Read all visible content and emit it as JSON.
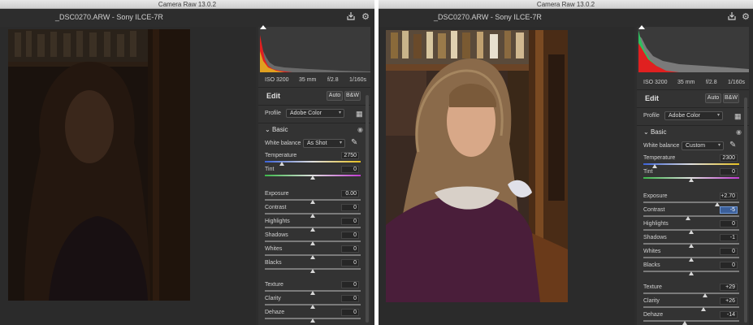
{
  "app_title": "Camera Raw 13.0.2",
  "file_info": "_DSC0270.ARW  -  Sony ILCE-7R",
  "icons": {
    "export": "export-icon",
    "settings": "gear-icon",
    "eyedropper": "eyedropper-icon",
    "grid": "profile-browser-icon",
    "visibility": "eye-icon",
    "collapse": "chevron-down-icon"
  },
  "colors": {
    "panel_bg": "#333333",
    "active_field": "#3b5f9a"
  },
  "exif": {
    "iso": "ISO 3200",
    "focal": "35 mm",
    "aperture": "f/2.8",
    "shutter": "1/160s"
  },
  "edit": {
    "title": "Edit",
    "auto_label": "Auto",
    "bw_label": "B&W"
  },
  "profile": {
    "label": "Profile",
    "value": "Adobe Color"
  },
  "basic_label": "Basic",
  "wb_label": "White balance",
  "left": {
    "wb_value": "As Shot",
    "sliders": [
      {
        "label": "Temperature",
        "value": "2750",
        "pos": 0.18
      },
      {
        "label": "Tint",
        "value": "0",
        "pos": 0.5
      },
      {
        "label": "Exposure",
        "value": "0.00",
        "pos": 0.5
      },
      {
        "label": "Contrast",
        "value": "0",
        "pos": 0.5
      },
      {
        "label": "Highlights",
        "value": "0",
        "pos": 0.5
      },
      {
        "label": "Shadows",
        "value": "0",
        "pos": 0.5
      },
      {
        "label": "Whites",
        "value": "0",
        "pos": 0.5
      },
      {
        "label": "Blacks",
        "value": "0",
        "pos": 0.5
      },
      {
        "label": "Texture",
        "value": "0",
        "pos": 0.5
      },
      {
        "label": "Clarity",
        "value": "0",
        "pos": 0.5
      },
      {
        "label": "Dehaze",
        "value": "0",
        "pos": 0.5
      }
    ]
  },
  "right": {
    "wb_value": "Custom",
    "sliders": [
      {
        "label": "Temperature",
        "value": "2300",
        "pos": 0.12
      },
      {
        "label": "Tint",
        "value": "0",
        "pos": 0.5
      },
      {
        "label": "Exposure",
        "value": "+2.70",
        "pos": 0.77
      },
      {
        "label": "Contrast",
        "value": "-5",
        "pos": 0.47
      },
      {
        "label": "Highlights",
        "value": "0",
        "pos": 0.5
      },
      {
        "label": "Shadows",
        "value": "-1",
        "pos": 0.5
      },
      {
        "label": "Whites",
        "value": "0",
        "pos": 0.5
      },
      {
        "label": "Blacks",
        "value": "0",
        "pos": 0.5
      },
      {
        "label": "Texture",
        "value": "+29",
        "pos": 0.64
      },
      {
        "label": "Clarity",
        "value": "+26",
        "pos": 0.63
      },
      {
        "label": "Dehaze",
        "value": "-14",
        "pos": 0.43
      }
    ]
  }
}
